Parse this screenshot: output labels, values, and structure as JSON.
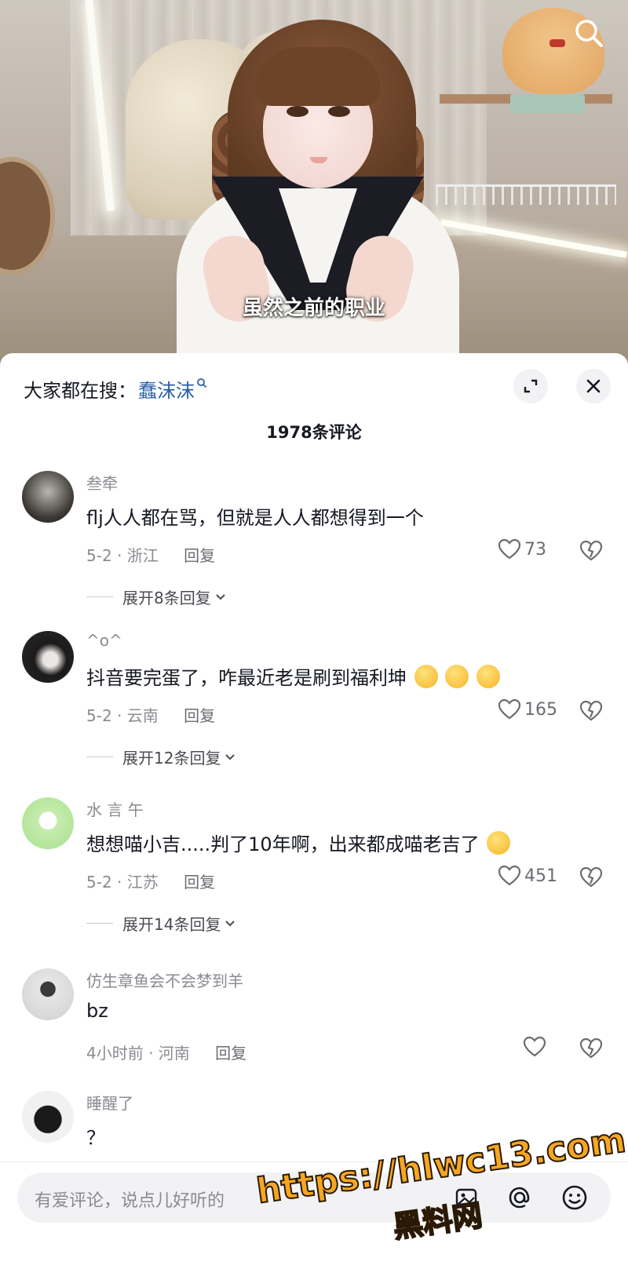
{
  "video": {
    "subtitle": "虽然之前的职业"
  },
  "hot_search": {
    "prefix": "大家都在搜：",
    "term": "蠢沫沫"
  },
  "comment_count": "1978条评论",
  "comments": [
    {
      "user": "叁牵",
      "text": "flj人人都在骂，但就是人人都想得到一个",
      "meta": "5-2 · 浙江",
      "reply": "回复",
      "likes": "73",
      "expand": "展开8条回复"
    },
    {
      "user": "^o^",
      "text": "抖音要完蛋了，咋最近老是刷到福利坤",
      "meta": "5-2 · 云南",
      "reply": "回复",
      "likes": "165",
      "expand": "展开12条回复"
    },
    {
      "user": "水 言 午",
      "text": "想想喵小吉.....判了10年啊，出来都成喵老吉了",
      "meta": "5-2 · 江苏",
      "reply": "回复",
      "likes": "451",
      "expand": "展开14条回复"
    },
    {
      "user": "仿生章鱼会不会梦到羊",
      "text": "bz",
      "meta": "4小时前 · 河南",
      "reply": "回复",
      "likes": ""
    },
    {
      "user": "睡醒了",
      "text": "？"
    }
  ],
  "input": {
    "placeholder": "有爱评论，说点儿好听的"
  },
  "watermark": {
    "url": "https://hlwc13.com",
    "name": "黑料网"
  },
  "colors": {
    "link": "#2b5ea8",
    "muted": "#8a8b91",
    "watermark": "#f6a623"
  }
}
